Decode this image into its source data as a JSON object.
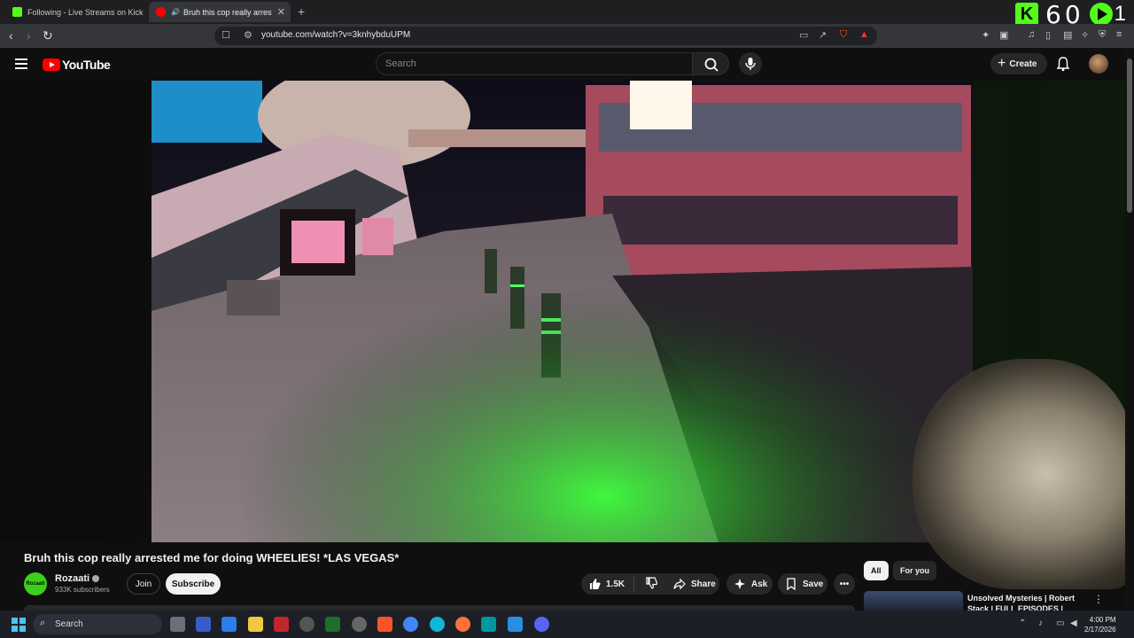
{
  "browser": {
    "tabs": [
      {
        "title": "Following - Live Streams on Kick",
        "active": false,
        "favicon_color": "#53fc18"
      },
      {
        "title": "Bruh this cop really arrested me",
        "active": true,
        "favicon_color": "#ff0000"
      }
    ],
    "url": "youtube.com/watch?v=3knhybduUPM"
  },
  "overlay": {
    "counter_number": "60",
    "counter_suffix": "1",
    "kick_letter": "K"
  },
  "youtube": {
    "logo_text": "YouTube",
    "search_placeholder": "Search",
    "create_label": "Create"
  },
  "video": {
    "title": "Bruh this cop really arrested me for doing WHEELIES! *LAS VEGAS*",
    "channel": {
      "name": "Rozaati",
      "subscribers": "933K subscribers",
      "avatar_text": "Rozaati"
    },
    "join_label": "Join",
    "subscribe_label": "Subscribe",
    "likes": "1.5K",
    "share_label": "Share",
    "ask_label": "Ask",
    "save_label": "Save"
  },
  "sidebar": {
    "chips": [
      "All",
      "For you"
    ],
    "recommendation_title": "Unsolved Mysteries | Robert Stack | FULL EPISODES |"
  },
  "taskbar": {
    "search_label": "Search",
    "time": "4:00 PM",
    "date": "2/17/2026"
  },
  "colors": {
    "kick_green": "#53fc18",
    "youtube_red": "#ff0000",
    "background": "#0f0f0f"
  }
}
